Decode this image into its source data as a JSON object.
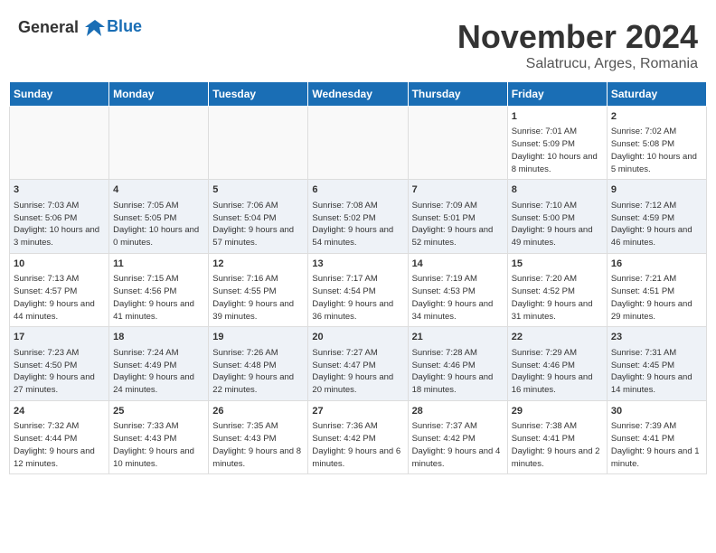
{
  "header": {
    "logo_line1": "General",
    "logo_line2": "Blue",
    "month_title": "November 2024",
    "location": "Salatrucu, Arges, Romania"
  },
  "days_of_week": [
    "Sunday",
    "Monday",
    "Tuesday",
    "Wednesday",
    "Thursday",
    "Friday",
    "Saturday"
  ],
  "weeks": [
    {
      "days": [
        {
          "num": "",
          "empty": true
        },
        {
          "num": "",
          "empty": true
        },
        {
          "num": "",
          "empty": true
        },
        {
          "num": "",
          "empty": true
        },
        {
          "num": "",
          "empty": true
        },
        {
          "num": "1",
          "sunrise": "7:01 AM",
          "sunset": "5:09 PM",
          "daylight": "10 hours and 8 minutes."
        },
        {
          "num": "2",
          "sunrise": "7:02 AM",
          "sunset": "5:08 PM",
          "daylight": "10 hours and 5 minutes."
        }
      ]
    },
    {
      "days": [
        {
          "num": "3",
          "sunrise": "7:03 AM",
          "sunset": "5:06 PM",
          "daylight": "10 hours and 3 minutes."
        },
        {
          "num": "4",
          "sunrise": "7:05 AM",
          "sunset": "5:05 PM",
          "daylight": "10 hours and 0 minutes."
        },
        {
          "num": "5",
          "sunrise": "7:06 AM",
          "sunset": "5:04 PM",
          "daylight": "9 hours and 57 minutes."
        },
        {
          "num": "6",
          "sunrise": "7:08 AM",
          "sunset": "5:02 PM",
          "daylight": "9 hours and 54 minutes."
        },
        {
          "num": "7",
          "sunrise": "7:09 AM",
          "sunset": "5:01 PM",
          "daylight": "9 hours and 52 minutes."
        },
        {
          "num": "8",
          "sunrise": "7:10 AM",
          "sunset": "5:00 PM",
          "daylight": "9 hours and 49 minutes."
        },
        {
          "num": "9",
          "sunrise": "7:12 AM",
          "sunset": "4:59 PM",
          "daylight": "9 hours and 46 minutes."
        }
      ]
    },
    {
      "days": [
        {
          "num": "10",
          "sunrise": "7:13 AM",
          "sunset": "4:57 PM",
          "daylight": "9 hours and 44 minutes."
        },
        {
          "num": "11",
          "sunrise": "7:15 AM",
          "sunset": "4:56 PM",
          "daylight": "9 hours and 41 minutes."
        },
        {
          "num": "12",
          "sunrise": "7:16 AM",
          "sunset": "4:55 PM",
          "daylight": "9 hours and 39 minutes."
        },
        {
          "num": "13",
          "sunrise": "7:17 AM",
          "sunset": "4:54 PM",
          "daylight": "9 hours and 36 minutes."
        },
        {
          "num": "14",
          "sunrise": "7:19 AM",
          "sunset": "4:53 PM",
          "daylight": "9 hours and 34 minutes."
        },
        {
          "num": "15",
          "sunrise": "7:20 AM",
          "sunset": "4:52 PM",
          "daylight": "9 hours and 31 minutes."
        },
        {
          "num": "16",
          "sunrise": "7:21 AM",
          "sunset": "4:51 PM",
          "daylight": "9 hours and 29 minutes."
        }
      ]
    },
    {
      "days": [
        {
          "num": "17",
          "sunrise": "7:23 AM",
          "sunset": "4:50 PM",
          "daylight": "9 hours and 27 minutes."
        },
        {
          "num": "18",
          "sunrise": "7:24 AM",
          "sunset": "4:49 PM",
          "daylight": "9 hours and 24 minutes."
        },
        {
          "num": "19",
          "sunrise": "7:26 AM",
          "sunset": "4:48 PM",
          "daylight": "9 hours and 22 minutes."
        },
        {
          "num": "20",
          "sunrise": "7:27 AM",
          "sunset": "4:47 PM",
          "daylight": "9 hours and 20 minutes."
        },
        {
          "num": "21",
          "sunrise": "7:28 AM",
          "sunset": "4:46 PM",
          "daylight": "9 hours and 18 minutes."
        },
        {
          "num": "22",
          "sunrise": "7:29 AM",
          "sunset": "4:46 PM",
          "daylight": "9 hours and 16 minutes."
        },
        {
          "num": "23",
          "sunrise": "7:31 AM",
          "sunset": "4:45 PM",
          "daylight": "9 hours and 14 minutes."
        }
      ]
    },
    {
      "days": [
        {
          "num": "24",
          "sunrise": "7:32 AM",
          "sunset": "4:44 PM",
          "daylight": "9 hours and 12 minutes."
        },
        {
          "num": "25",
          "sunrise": "7:33 AM",
          "sunset": "4:43 PM",
          "daylight": "9 hours and 10 minutes."
        },
        {
          "num": "26",
          "sunrise": "7:35 AM",
          "sunset": "4:43 PM",
          "daylight": "9 hours and 8 minutes."
        },
        {
          "num": "27",
          "sunrise": "7:36 AM",
          "sunset": "4:42 PM",
          "daylight": "9 hours and 6 minutes."
        },
        {
          "num": "28",
          "sunrise": "7:37 AM",
          "sunset": "4:42 PM",
          "daylight": "9 hours and 4 minutes."
        },
        {
          "num": "29",
          "sunrise": "7:38 AM",
          "sunset": "4:41 PM",
          "daylight": "9 hours and 2 minutes."
        },
        {
          "num": "30",
          "sunrise": "7:39 AM",
          "sunset": "4:41 PM",
          "daylight": "9 hours and 1 minute."
        }
      ]
    }
  ]
}
